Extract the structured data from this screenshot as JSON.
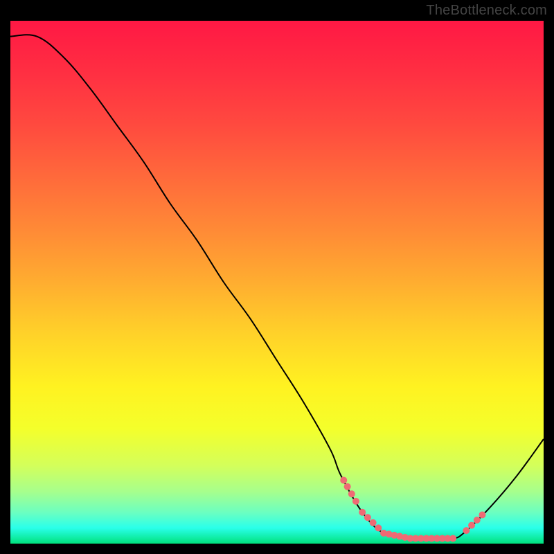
{
  "watermark": "TheBottleneck.com",
  "gradient": {
    "stops": [
      {
        "offset": 0.0,
        "color": "#ff1844"
      },
      {
        "offset": 0.1,
        "color": "#ff2f42"
      },
      {
        "offset": 0.2,
        "color": "#ff4a3f"
      },
      {
        "offset": 0.3,
        "color": "#ff6a3b"
      },
      {
        "offset": 0.4,
        "color": "#ff8a36"
      },
      {
        "offset": 0.5,
        "color": "#ffad30"
      },
      {
        "offset": 0.6,
        "color": "#ffd229"
      },
      {
        "offset": 0.7,
        "color": "#fff221"
      },
      {
        "offset": 0.78,
        "color": "#f4ff2b"
      },
      {
        "offset": 0.85,
        "color": "#d4ff5a"
      },
      {
        "offset": 0.9,
        "color": "#a7ff8c"
      },
      {
        "offset": 0.94,
        "color": "#6cffc0"
      },
      {
        "offset": 0.97,
        "color": "#2affea"
      },
      {
        "offset": 1.0,
        "color": "#00e27c"
      }
    ]
  },
  "chart_data": {
    "type": "line",
    "title": "",
    "xlabel": "",
    "ylabel": "",
    "xlim": [
      0,
      100
    ],
    "ylim": [
      0,
      100
    ],
    "series": [
      {
        "name": "curve",
        "x": [
          0,
          5,
          10,
          15,
          20,
          25,
          30,
          35,
          40,
          45,
          50,
          55,
          60,
          62,
          66,
          70,
          75,
          80,
          83,
          85,
          90,
          95,
          100
        ],
        "values": [
          97,
          97,
          93,
          87,
          80,
          73,
          65,
          58,
          50,
          43,
          35,
          27,
          18,
          13,
          6,
          2,
          1,
          1,
          1,
          2,
          7,
          13,
          20
        ]
      }
    ],
    "markers": {
      "note": "approximate dotted marker segments on curve (x positions, y follows curve)",
      "segments": [
        {
          "x": [
            62.5,
            63.2,
            64.0,
            64.8
          ],
          "style": "dot"
        },
        {
          "x": [
            66.0,
            67.0,
            68.0,
            69.0,
            70.0,
            71.0,
            72.0,
            73.0,
            74.0,
            75.0,
            76.0,
            77.0,
            78.0,
            79.0,
            80.0,
            81.0,
            82.0,
            83.0
          ],
          "style": "dot"
        },
        {
          "x": [
            85.5,
            86.5,
            87.5,
            88.5
          ],
          "style": "dot"
        }
      ],
      "color": "#ef6a74",
      "radius": 5
    },
    "stroke": {
      "color": "#000000",
      "width": 2
    }
  }
}
